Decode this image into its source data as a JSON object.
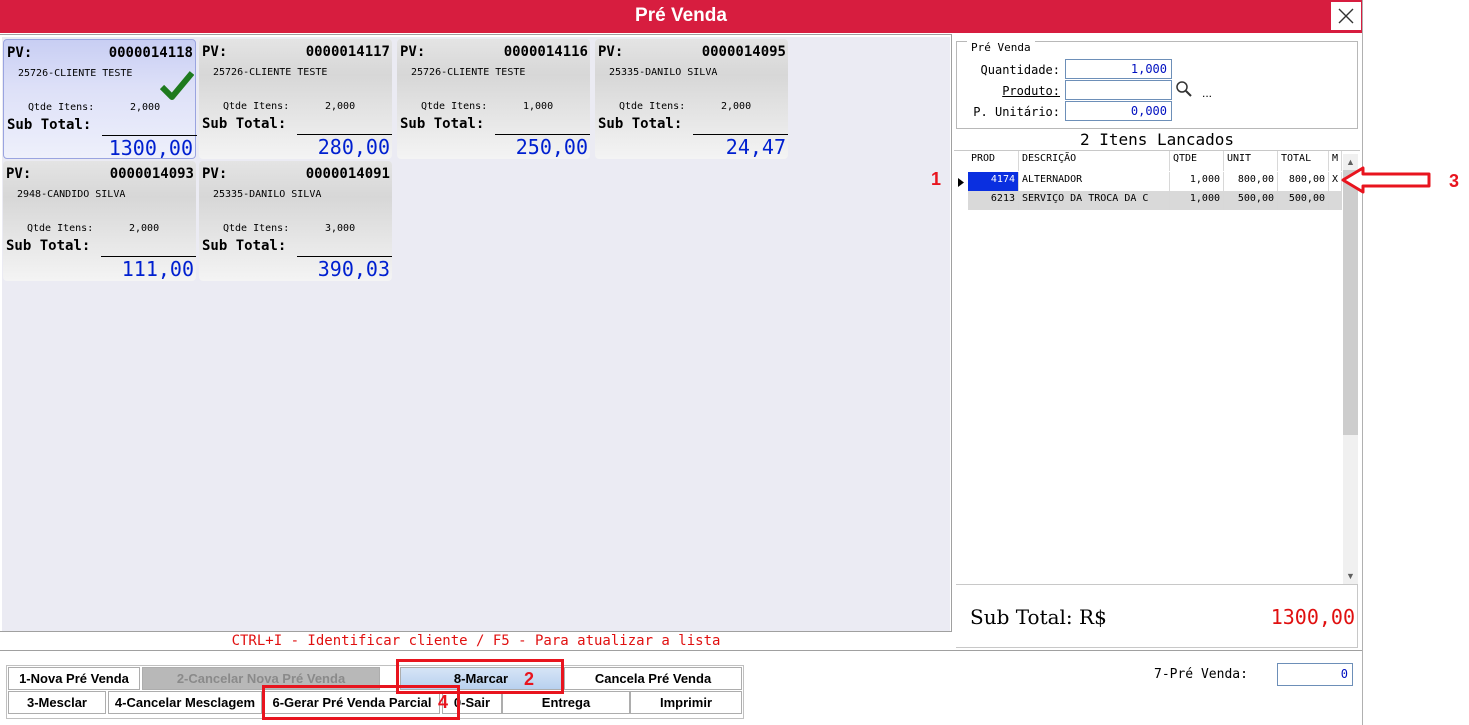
{
  "window": {
    "title": "Pré Venda"
  },
  "cards": [
    {
      "pv_label": "PV:",
      "number": "0000014118",
      "client": "25726-CLIENTE TESTE",
      "qtde_label": "Qtde Itens:",
      "qtde": "2,000",
      "sub_label": "Sub Total:",
      "subtotal": "1300,00",
      "selected": true
    },
    {
      "pv_label": "PV:",
      "number": "0000014117",
      "client": "25726-CLIENTE TESTE",
      "qtde_label": "Qtde Itens:",
      "qtde": "2,000",
      "sub_label": "Sub Total:",
      "subtotal": "280,00",
      "selected": false
    },
    {
      "pv_label": "PV:",
      "number": "0000014116",
      "client": "25726-CLIENTE TESTE",
      "qtde_label": "Qtde Itens:",
      "qtde": "1,000",
      "sub_label": "Sub Total:",
      "subtotal": "250,00",
      "selected": false
    },
    {
      "pv_label": "PV:",
      "number": "0000014095",
      "client": "25335-DANILO SILVA",
      "qtde_label": "Qtde Itens:",
      "qtde": "2,000",
      "sub_label": "Sub Total:",
      "subtotal": "24,47",
      "selected": false
    },
    {
      "pv_label": "PV:",
      "number": "0000014093",
      "client": "2948-CANDIDO SILVA",
      "qtde_label": "Qtde Itens:",
      "qtde": "2,000",
      "sub_label": "Sub Total:",
      "subtotal": "111,00",
      "selected": false
    },
    {
      "pv_label": "PV:",
      "number": "0000014091",
      "client": "25335-DANILO SILVA",
      "qtde_label": "Qtde Itens:",
      "qtde": "3,000",
      "sub_label": "Sub Total:",
      "subtotal": "390,03",
      "selected": false
    }
  ],
  "hint": "CTRL+I - Identificar cliente / F5 - Para atualizar a lista",
  "pre_venda_group": {
    "title": "Pré Venda",
    "quantidade_label": "Quantidade:",
    "quantidade_value": "1,000",
    "produto_label": "Produto:",
    "produto_value": "",
    "unitario_label": "P. Unitário:",
    "unitario_value": "0,000",
    "more_label": "..."
  },
  "items": {
    "title": "2 Itens Lancados",
    "columns": [
      "PROD",
      "DESCRIÇÃO",
      "QTDE",
      "UNIT",
      "TOTAL",
      "M"
    ],
    "rows": [
      {
        "prod": "4174",
        "descricao": "ALTERNADOR",
        "qtde": "1,000",
        "unit": "800,00",
        "total": "800,00",
        "m": "X"
      },
      {
        "prod": "6213",
        "descricao": "SERVIÇO DA TROCA DA C",
        "qtde": "1,000",
        "unit": "500,00",
        "total": "500,00",
        "m": ""
      }
    ]
  },
  "subtotal": {
    "label": "Sub Total: R$",
    "value": "1300,00"
  },
  "buttons": {
    "nova": "1-Nova Pré Venda",
    "cancelar_nova": "2-Cancelar Nova Pré Venda",
    "marcar": "8-Marcar",
    "cancela": "Cancela Pré Venda",
    "mesclar": "3-Mesclar",
    "cancelar_mesclagem": "4-Cancelar Mesclagem",
    "gerar_parcial": "6-Gerar Pré Venda Parcial",
    "sair": "0-Sair",
    "entrega": "Entrega",
    "imprimir": "Imprimir"
  },
  "pre_venda_field": {
    "label": "7-Pré Venda:",
    "value": "0"
  },
  "annotations": {
    "n1": "1",
    "n2": "2",
    "n3": "3",
    "n4": "4"
  },
  "colors": {
    "title_bar": "#d71d3f",
    "subtotal_blue": "#0020d0",
    "alert_red": "#e01010",
    "annotation_red": "#e8141e"
  }
}
